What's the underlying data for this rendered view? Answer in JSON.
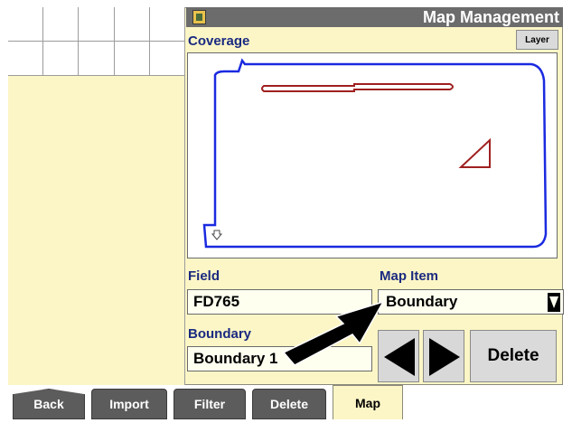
{
  "window": {
    "title": "Map Management",
    "title_icon": "display-icon"
  },
  "coverage": {
    "label": "Coverage",
    "layer_button": "Layer"
  },
  "field": {
    "label": "Field",
    "value": "FD765"
  },
  "map_item": {
    "label": "Map Item",
    "value": "Boundary"
  },
  "boundary": {
    "label": "Boundary",
    "value": "Boundary 1"
  },
  "buttons": {
    "prev_icon": "arrow-left-icon",
    "next_icon": "arrow-right-icon",
    "delete": "Delete"
  },
  "tabs": [
    {
      "label": "Back"
    },
    {
      "label": "Import"
    },
    {
      "label": "Filter"
    },
    {
      "label": "Delete"
    },
    {
      "label": "Map"
    }
  ],
  "colors": {
    "background": "#fcf6c6",
    "title_bar": "#6c6c6c",
    "label_text": "#1a2a80",
    "field_boundary": "#1a2ae0",
    "obstacle": "#a02020",
    "tab_inactive": "#5c5c5c"
  }
}
